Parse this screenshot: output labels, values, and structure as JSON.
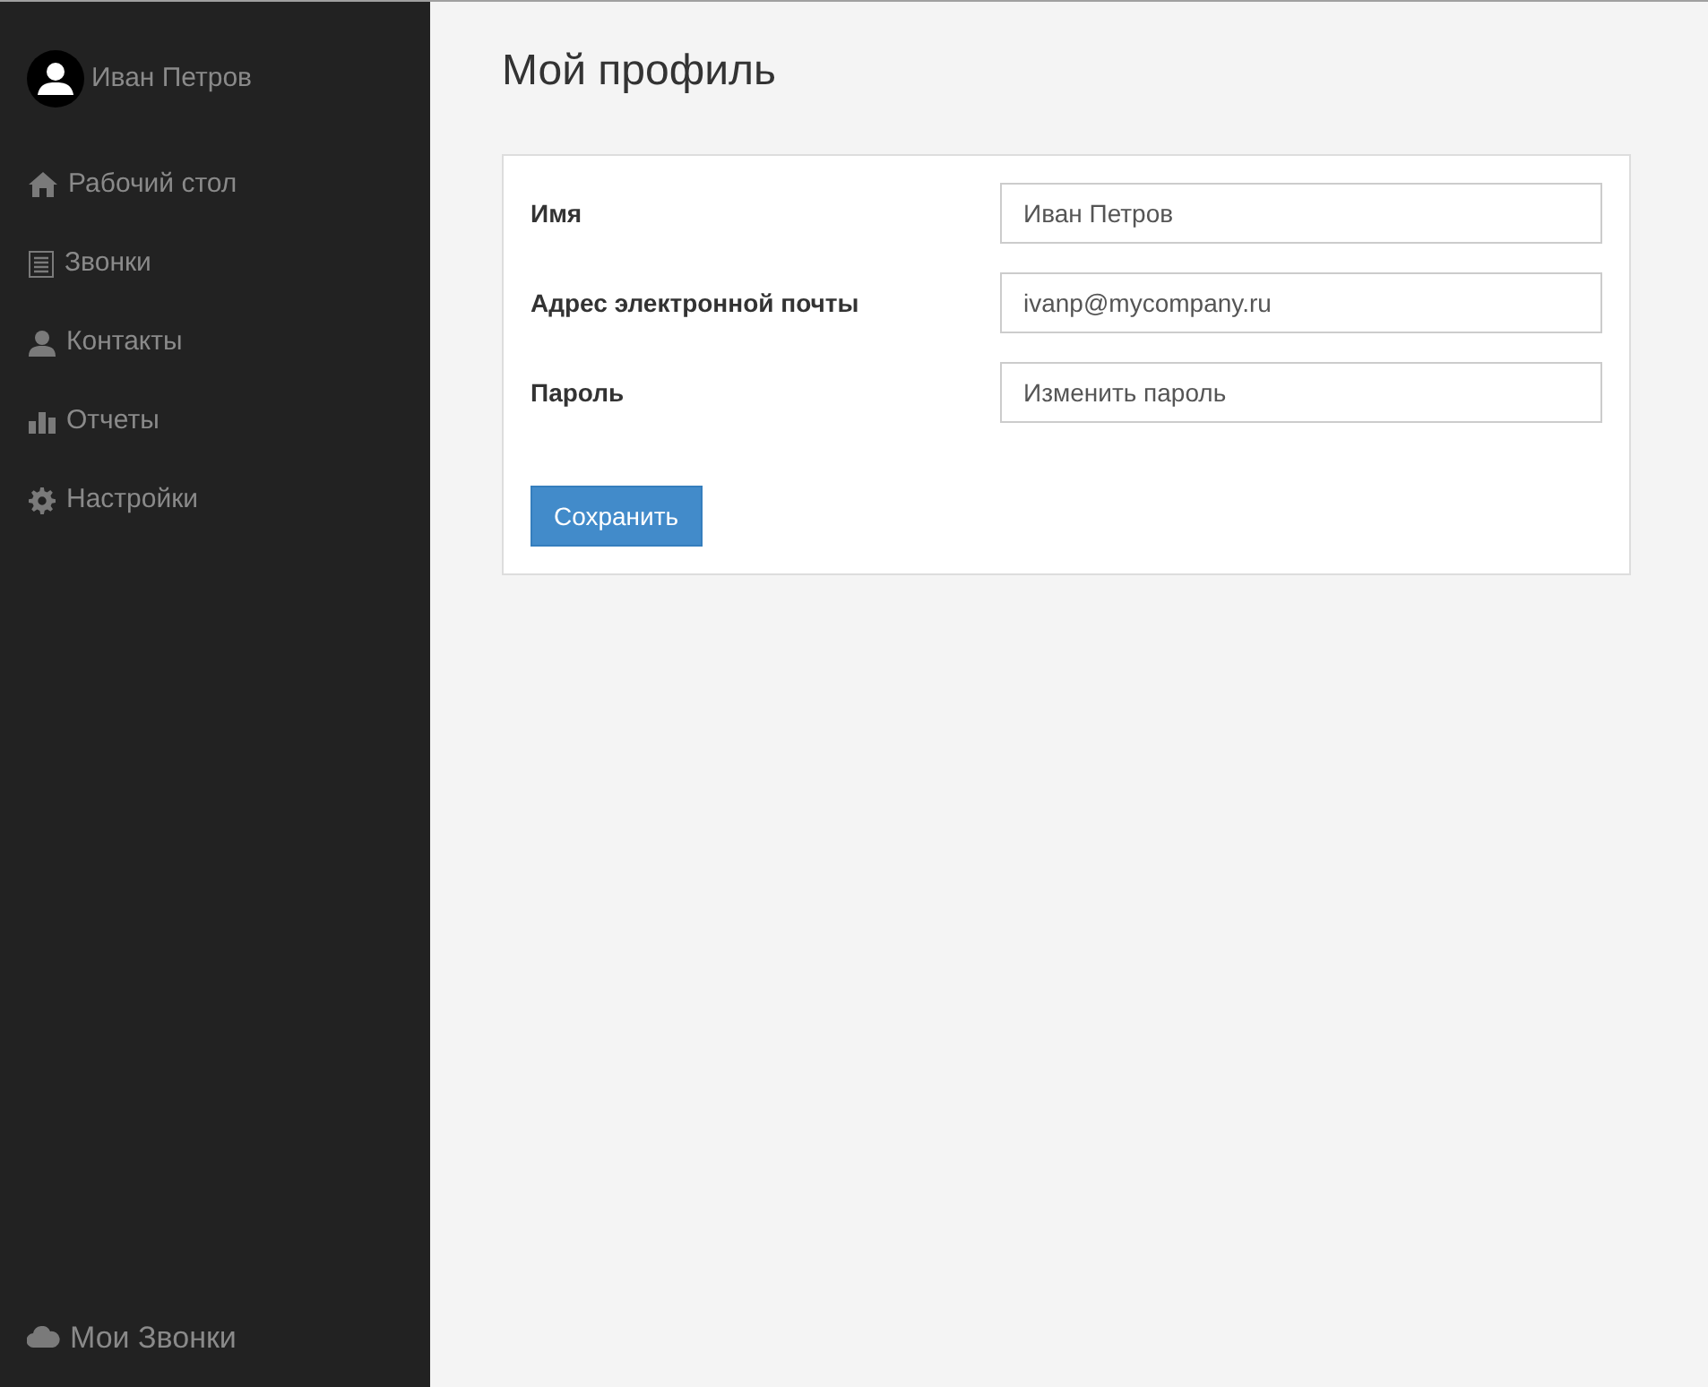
{
  "sidebar": {
    "user": {
      "name": "Иван Петров"
    },
    "items": [
      {
        "kind": "home",
        "label": "Рабочий стол"
      },
      {
        "kind": "list",
        "label": "Звонки"
      },
      {
        "kind": "person",
        "label": "Контакты"
      },
      {
        "kind": "chart",
        "label": "Отчеты"
      },
      {
        "kind": "gear",
        "label": "Настройки"
      }
    ],
    "footer": {
      "label": "Мои Звонки"
    }
  },
  "page": {
    "title": "Мой профиль",
    "fields": [
      {
        "label": "Имя",
        "value": "Иван Петров"
      },
      {
        "label": "Адрес электронной почты",
        "value": "ivanp@mycompany.ru"
      },
      {
        "label": "Пароль",
        "value": "Изменить пароль"
      }
    ],
    "save_button": "Сохранить"
  }
}
